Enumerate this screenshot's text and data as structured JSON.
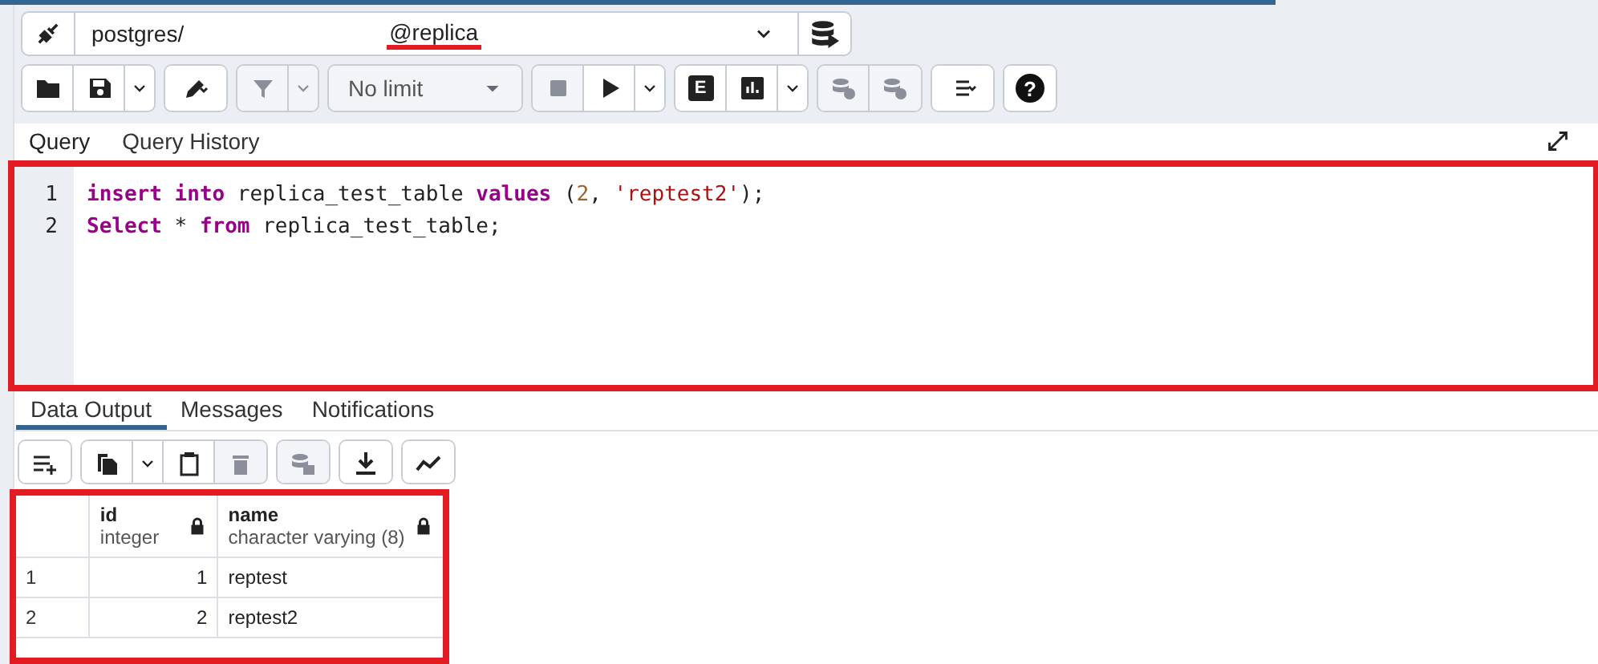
{
  "connection": {
    "user": "postgres/",
    "database": "@replica"
  },
  "toolbar": [
    [
      {
        "kind": "folder",
        "disabled": false
      },
      {
        "kind": "save",
        "disabled": false
      },
      {
        "kind": "caret",
        "disabled": false
      }
    ],
    [
      {
        "kind": "pencil-caret",
        "disabled": false
      }
    ],
    [
      {
        "kind": "filter",
        "disabled": true
      },
      {
        "kind": "caret",
        "disabled": true
      }
    ],
    [
      {
        "kind": "limit",
        "label": "No limit"
      }
    ],
    [
      {
        "kind": "stop",
        "disabled": true
      },
      {
        "kind": "play",
        "disabled": false
      },
      {
        "kind": "caret",
        "disabled": false
      }
    ],
    [
      {
        "kind": "letter",
        "label": "E",
        "disabled": false
      },
      {
        "kind": "bars",
        "disabled": false
      },
      {
        "kind": "caret",
        "disabled": false
      }
    ],
    [
      {
        "kind": "db-check",
        "disabled": true
      },
      {
        "kind": "db-undo",
        "disabled": true
      }
    ],
    [
      {
        "kind": "list-caret",
        "disabled": false
      }
    ],
    [
      {
        "kind": "help",
        "label": "?",
        "disabled": false
      }
    ]
  ],
  "query_tabs": [
    {
      "label": "Query",
      "selected": true
    },
    {
      "label": "Query History",
      "selected": false
    }
  ],
  "editor": {
    "lines": [
      {
        "number": "1",
        "tokens": [
          {
            "kind": "keyword",
            "text": "insert "
          },
          {
            "kind": "keyword",
            "text": "into"
          },
          {
            "kind": "plain",
            "text": " replica_test_table "
          },
          {
            "kind": "keyword",
            "text": "values"
          },
          {
            "kind": "plain",
            "text": " ("
          },
          {
            "kind": "number",
            "text": "2"
          },
          {
            "kind": "plain",
            "text": ", "
          },
          {
            "kind": "string",
            "text": "'reptest2'"
          },
          {
            "kind": "plain",
            "text": ");"
          }
        ]
      },
      {
        "number": "2",
        "tokens": [
          {
            "kind": "keyword",
            "text": "Select"
          },
          {
            "kind": "plain",
            "text": " * "
          },
          {
            "kind": "keyword",
            "text": "from"
          },
          {
            "kind": "plain",
            "text": " replica_test_table;"
          }
        ]
      }
    ]
  },
  "result_tabs": [
    {
      "label": "Data Output",
      "selected": true
    },
    {
      "label": "Messages",
      "selected": false
    },
    {
      "label": "Notifications",
      "selected": false
    }
  ],
  "result_toolbar": [
    [
      {
        "kind": "add-row",
        "disabled": false
      }
    ],
    [
      {
        "kind": "copy",
        "disabled": false
      },
      {
        "kind": "caret",
        "disabled": false
      },
      {
        "kind": "paste",
        "disabled": false
      },
      {
        "kind": "trash",
        "disabled": true
      }
    ],
    [
      {
        "kind": "db-save",
        "disabled": true
      }
    ],
    [
      {
        "kind": "download",
        "disabled": false
      }
    ],
    [
      {
        "kind": "graph",
        "disabled": false
      }
    ]
  ],
  "table": {
    "columns": [
      {
        "name": "id",
        "type": "integer"
      },
      {
        "name": "name",
        "type": "character varying (8)"
      }
    ],
    "rows": [
      {
        "number": "1",
        "cells": [
          "1",
          "reptest"
        ]
      },
      {
        "number": "2",
        "cells": [
          "2",
          "reptest2"
        ]
      }
    ]
  }
}
